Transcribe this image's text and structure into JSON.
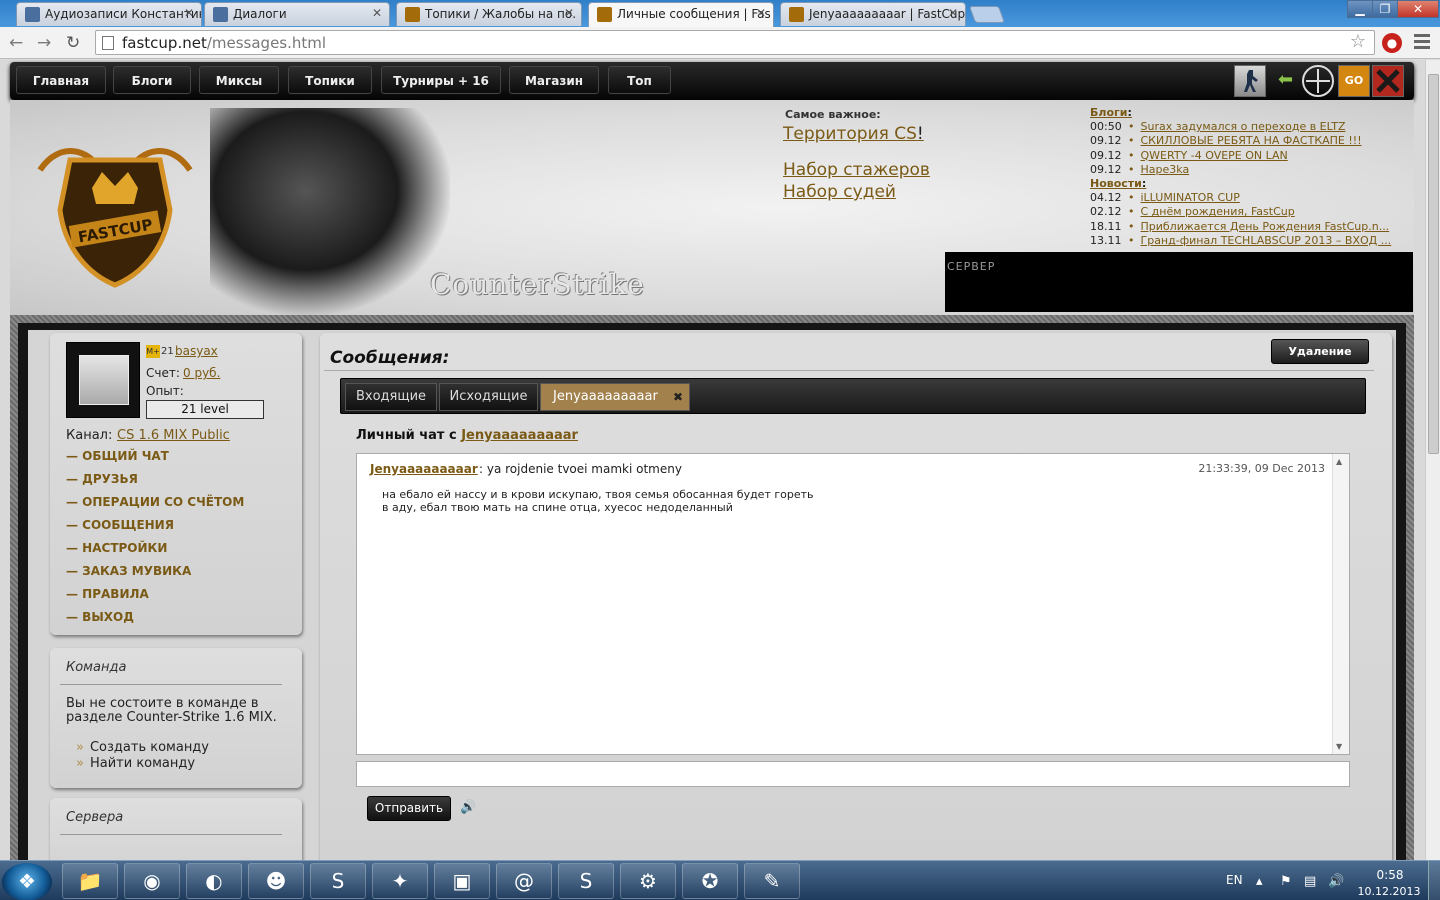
{
  "browser": {
    "tabs": [
      {
        "title": "Аудиозаписи Константин",
        "favicon_color": "#4a6f9e"
      },
      {
        "title": "Диалоги",
        "favicon_color": "#4a6f9e"
      },
      {
        "title": "Топики / Жалобы на по.",
        "favicon_color": "#a36b0a"
      },
      {
        "title": "Личные сообщения | Fas",
        "favicon_color": "#a36b0a"
      },
      {
        "title": "Jenyaaaaaaaaar | FastCup",
        "favicon_color": "#a36b0a"
      }
    ],
    "active_tab": 3,
    "url_host": "fastcup.net",
    "url_path": "/messages.html",
    "window_controls": [
      "minimize",
      "restore",
      "close"
    ]
  },
  "site": {
    "nav": [
      "Главная",
      "Блоги",
      "Миксы",
      "Топики",
      "Турниры + 16",
      "Магазин",
      "Топ"
    ],
    "game_icons": [
      "counter-strike-icon",
      "arrow-icon",
      "crosshair-icon",
      "csgo-icon",
      "dota-icon"
    ],
    "header": {
      "logo_text": "FASTCUP",
      "banner_title": "CounterStrike",
      "important_label": "Самое важное:",
      "important_links": [
        "Территория CS",
        "Набор стажеров",
        "Набор судей"
      ],
      "important_suffix": "!",
      "blogs_label": "Блоги",
      "blogs": [
        {
          "time": "00:50",
          "title": "Surax задумался о переходе в ELTZ"
        },
        {
          "time": "09.12",
          "title": "СКИЛЛОВЫЕ РЕБЯТА НА ФАСТКАПЕ !!!"
        },
        {
          "time": "09.12",
          "title": "QWERTY -4 OVEPE ON LAN"
        },
        {
          "time": "09.12",
          "title": "Hape3ka"
        }
      ],
      "news_label": "Новости",
      "news": [
        {
          "time": "04.12",
          "title": "iLLUMINATOR CUP"
        },
        {
          "time": "02.12",
          "title": "С днём рождения, FastCup"
        },
        {
          "time": "18.11",
          "title": "Приближается День Рождения FastCup.n..."
        },
        {
          "time": "13.11",
          "title": "Гранд-финал TECHLABSCUP 2013 – ВХОД ..."
        }
      ],
      "server_label": "СЕРВЕР"
    },
    "user": {
      "badge": "M+",
      "level_num": "21",
      "name": "basyax",
      "account_label": "Счет:",
      "account_value": "0 руб.",
      "exp_label": "Опыт:",
      "level": "21 level",
      "channel_label": "Канал:",
      "channel": "CS 1.6 MIX Public"
    },
    "side_menu": [
      "— ОБЩИЙ ЧАТ",
      "— ДРУЗЬЯ",
      "— ОПЕРАЦИИ СО СЧЁТОМ",
      "— СООБЩЕНИЯ",
      "— НАСТРОЙКИ",
      "— ЗАКАЗ МУВИКА",
      "— ПРАВИЛА",
      "— ВЫХОД"
    ],
    "team": {
      "title": "Команда",
      "message": "Вы не состоите в команде в разделе Counter-Strike 1.6 MIX.",
      "links": [
        "Создать команду",
        "Найти команду"
      ],
      "bullet": "»"
    },
    "servers_title": "Сервера",
    "messages": {
      "title": "Сообщения:",
      "delete_label": "Удаление",
      "tabs": [
        "Входящие",
        "Исходящие",
        "Jenyaaaaaaaaar"
      ],
      "close_tab": "✖",
      "chat_prefix": "Личный чат с",
      "chat_user": "Jenyaaaaaaaaar",
      "message": {
        "author": "Jenyaaaaaaaaar",
        "subject": ": ya rojdenie tvoei mamki otmeny",
        "time": "21:33:39, 09 Dec 2013",
        "body_line1": "на ебало ей нассу  и в крови искупаю, твоя семья обосанная будет гореть",
        "body_line2": "в аду, ебал твою мать на спине отца, хуесос недоделанный"
      },
      "send_label": "Отправить"
    }
  },
  "taskbar": {
    "apps": [
      "folder-icon",
      "chrome-icon",
      "teamspeak-icon",
      "qip-icon",
      "skype-icon",
      "battlenet-icon",
      "window-icon",
      "mail-agent-icon",
      "skype-icon",
      "steam-icon",
      "counter-strike-icon",
      "paint-icon"
    ],
    "lang": "EN",
    "time": "0:58",
    "date": "10.12.2013"
  }
}
